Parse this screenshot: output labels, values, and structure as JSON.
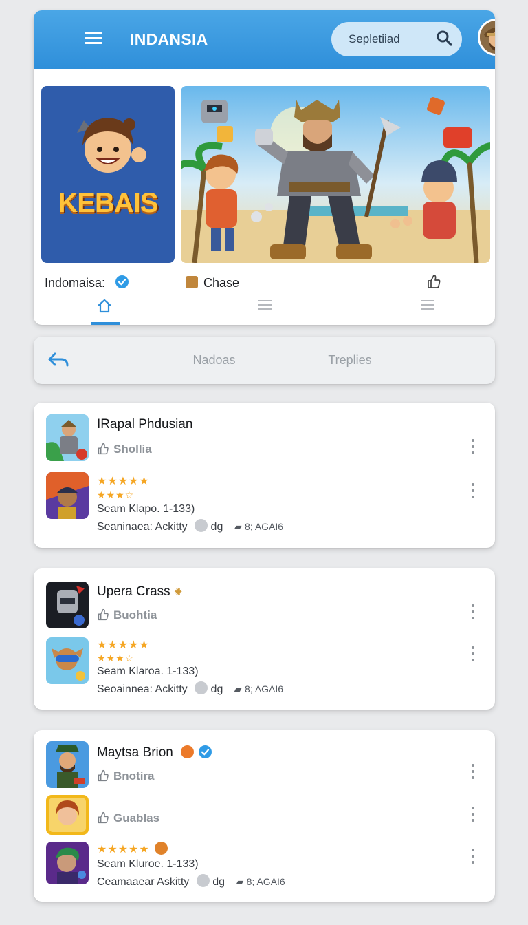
{
  "app": {
    "title": "INDANSIA"
  },
  "search": {
    "placeholder": "Sepletiiad"
  },
  "featured": {
    "logo_text": "KEBAIS",
    "left_caption": "Indomaisa:",
    "mid_caption": "Chase"
  },
  "colors": {
    "accent": "#2f8fda",
    "star": "#f5a623"
  },
  "reply_bar": {
    "tab1": "Nadoas",
    "tab2": "Treplies"
  },
  "cards": [
    {
      "title": "IRapal Phdusian",
      "subtitle": "Shollia",
      "rating_line1": "★★★★★",
      "rating_line2": "★★★☆",
      "meta1": "Seam Klapo. 1-133)",
      "meta2": "Seaninaea: Ackitty",
      "meta2_tag": "dg",
      "meta2_code": "8; AGAI6"
    },
    {
      "title": "Upera Crass",
      "subtitle": "Buohtia",
      "rating_line1": "★★★★★",
      "rating_line2": "★★★☆",
      "meta1": "Seam Klaroa. 1-133)",
      "meta2": "Seoainnea: Ackitty",
      "meta2_tag": "dg",
      "meta2_code": "8; AGAI6"
    },
    {
      "title": "Maytsa Brion",
      "subtitle": "Bnotira",
      "subtitle2": "Guablas",
      "rating_line1": "★★★★★",
      "meta1": "Seam Kluroe. 1-133)",
      "meta2": "Ceamaaear Askitty",
      "meta2_tag": "dg",
      "meta2_code": "8; AGAI6"
    }
  ]
}
